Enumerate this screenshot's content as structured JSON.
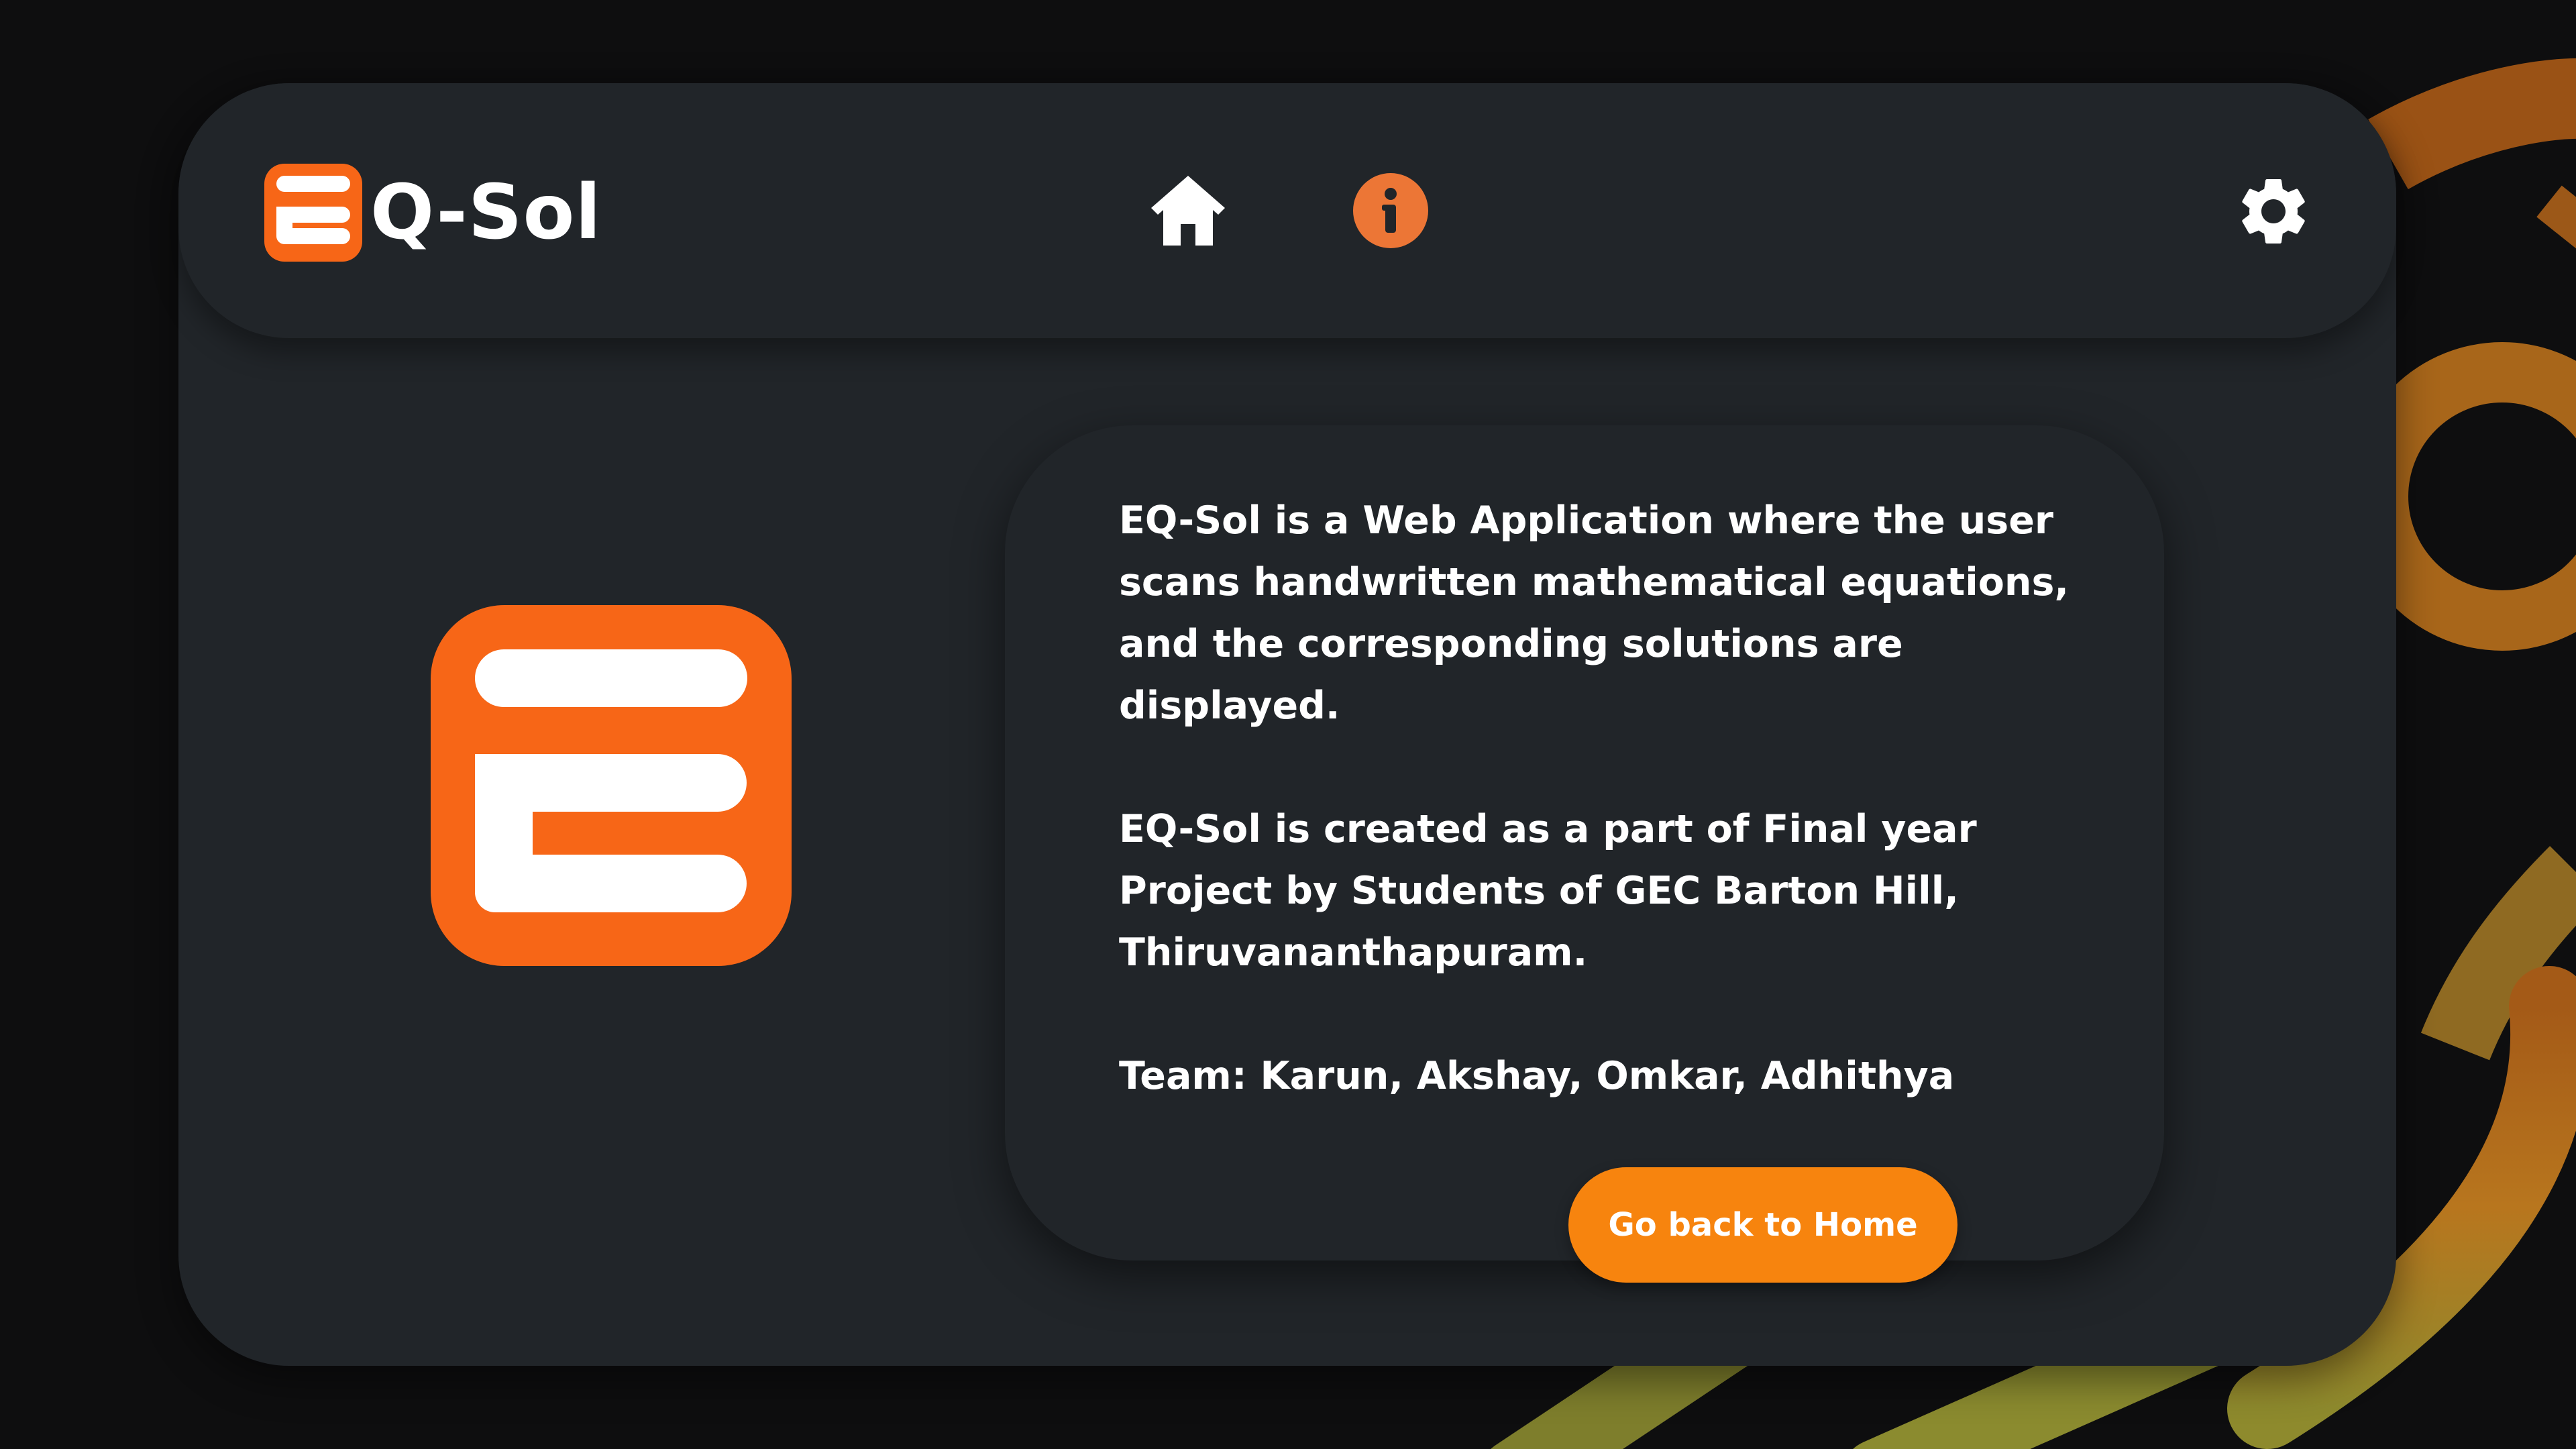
{
  "app": {
    "brand_name": "Q-Sol",
    "logo_icon": "eq-sol-logo-icon"
  },
  "navbar": {
    "items": [
      {
        "name": "home",
        "icon": "home-icon"
      },
      {
        "name": "about",
        "icon": "info-icon",
        "active": true
      },
      {
        "name": "settings",
        "icon": "gear-icon"
      }
    ]
  },
  "about": {
    "paragraph_1": "EQ-Sol is a Web Application where the user scans handwritten mathematical equations, and the corresponding solutions are displayed.",
    "paragraph_2": "EQ-Sol is created as a part of Final year Project by Students of GEC Barton Hill, Thiruvananthapuram.",
    "paragraph_3": "Team: Karun, Akshay, Omkar, Adhithya",
    "button_label": "Go back to Home"
  },
  "colors": {
    "background": "#0e0e0f",
    "card": "#212529",
    "brand_orange": "#f76617",
    "button_orange": "#f7840e",
    "info_icon": "#ec7636",
    "text": "#ffffff"
  }
}
